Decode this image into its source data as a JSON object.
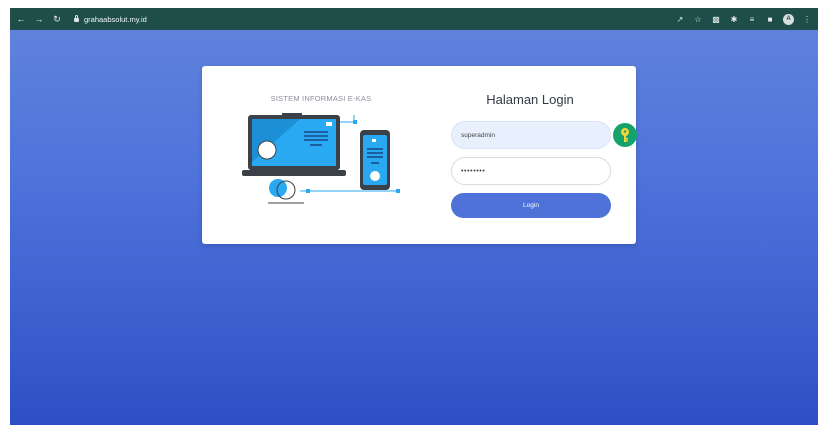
{
  "browser": {
    "url": "grahaabsolut.my.id",
    "avatar_letter": "A",
    "icons": [
      "back-icon",
      "forward-icon",
      "reload-icon",
      "lock-icon",
      "share-icon",
      "star-icon",
      "extension-icon",
      "puzzle-icon",
      "queue-icon",
      "sidebar-icon",
      "avatar",
      "menu-icon"
    ]
  },
  "card": {
    "brand": "SISTEM INFORMASI E-KAS",
    "title": "Halaman Login",
    "username_value": "superadmin",
    "password_value": "••••••••",
    "login_label": "Login"
  },
  "colors": {
    "toolbar": "#1f4d4a",
    "page_gradient_top": "#5f82dc",
    "page_gradient_bottom": "#2e4fc4",
    "accent": "#4e72d8",
    "illustration_blue": "#29a9f2",
    "key_green": "#15a36b",
    "key_yellow": "#f2d53a"
  }
}
